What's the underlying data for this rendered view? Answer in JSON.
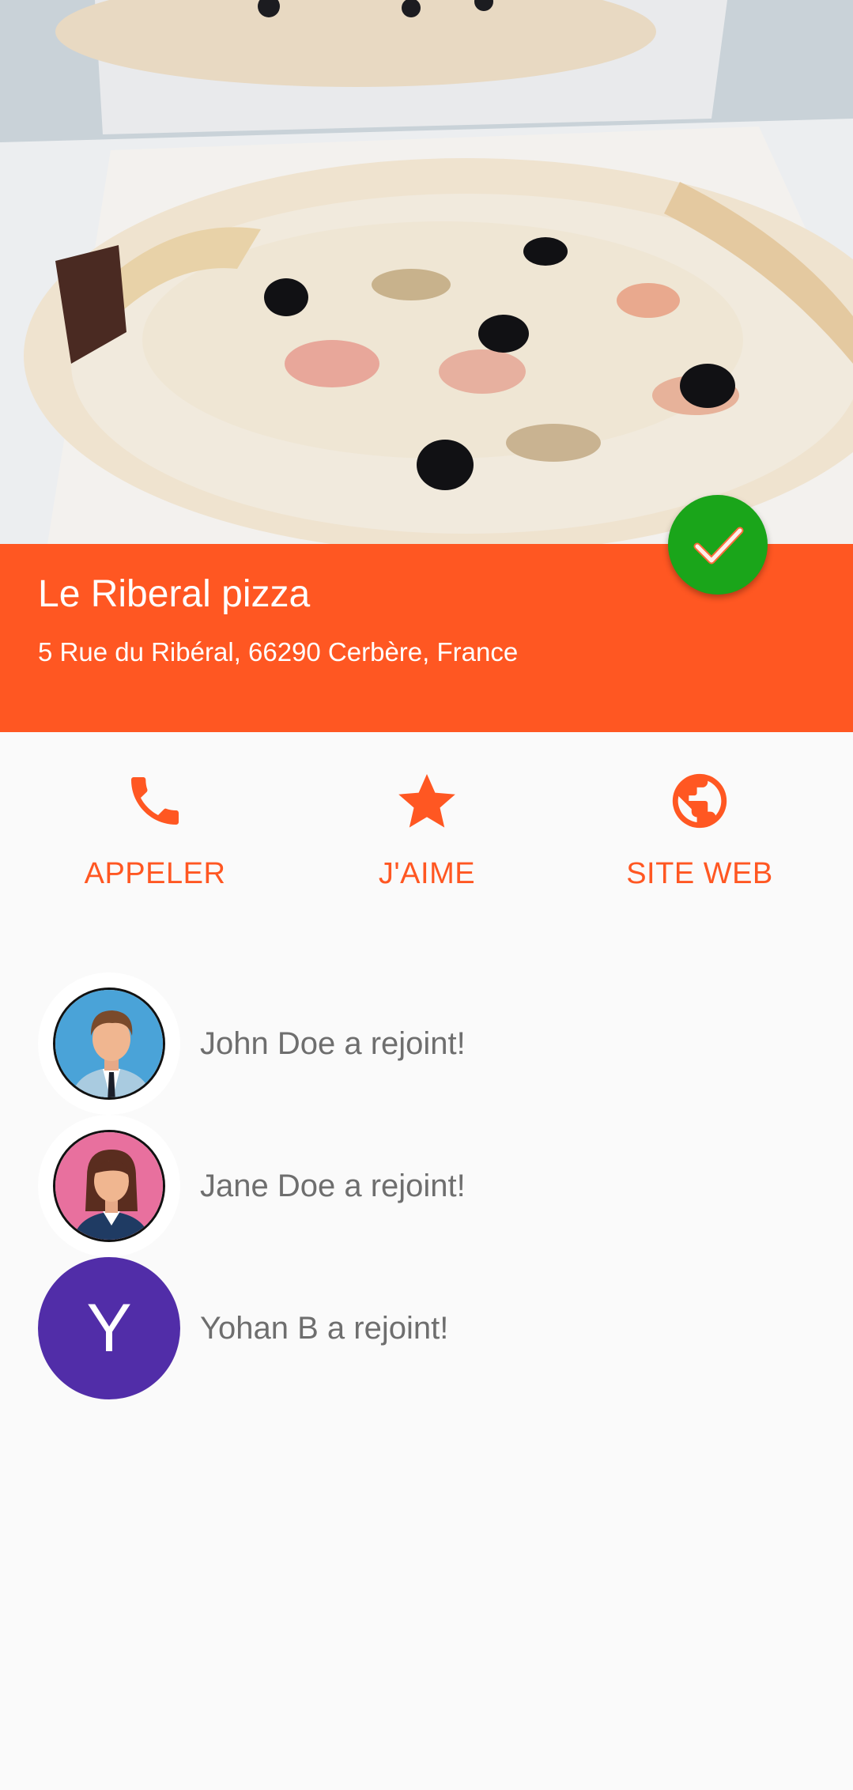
{
  "restaurant": {
    "name": "Le Riberal pizza",
    "address": "5 Rue du Ribéral, 66290 Cerbère, France"
  },
  "status": {
    "icon": "check-icon",
    "color": "#1aa51a"
  },
  "actions": [
    {
      "label": "APPELER",
      "icon": "phone-icon"
    },
    {
      "label": "J'AIME",
      "icon": "star-icon"
    },
    {
      "label": "SITE WEB",
      "icon": "globe-icon"
    }
  ],
  "activity": [
    {
      "text": "John Doe a rejoint!",
      "avatar": "man-avatar"
    },
    {
      "text": "Jane Doe a rejoint!",
      "avatar": "woman-avatar"
    },
    {
      "text": "Yohan B a rejoint!",
      "avatar_letter": "Y",
      "avatar_color": "#512da8"
    }
  ],
  "colors": {
    "accent": "#ff5722",
    "background": "#fafafa"
  }
}
